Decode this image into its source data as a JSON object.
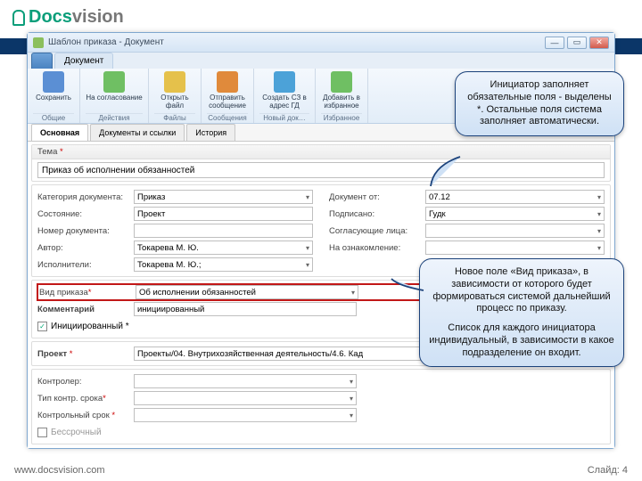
{
  "brand": {
    "name1": "Docs",
    "name2": "vision"
  },
  "window": {
    "title": "Шаблон приказа - Документ",
    "min": "—",
    "max": "▭",
    "close": "✕"
  },
  "ribbon": {
    "file_tab": "",
    "doc_tab": "Документ",
    "groups": [
      {
        "label": "Общие",
        "items": [
          {
            "label": "Сохранить",
            "color": "#5b8fd4"
          }
        ]
      },
      {
        "label": "Действия",
        "items": [
          {
            "label": "На согласование",
            "color": "#6fbf63"
          }
        ]
      },
      {
        "label": "Файлы",
        "items": [
          {
            "label": "Открыть файл",
            "color": "#e5c14b"
          }
        ]
      },
      {
        "label": "Сообщения",
        "items": [
          {
            "label": "Отправить сообщение",
            "color": "#e08a3b"
          }
        ]
      },
      {
        "label": "Новый док…",
        "items": [
          {
            "label": "Создать СЗ в адрес ГД",
            "color": "#4ca2d8"
          }
        ]
      },
      {
        "label": "Избранное",
        "items": [
          {
            "label": "Добавить в избранное",
            "color": "#6fbf63"
          }
        ]
      }
    ]
  },
  "doctabs": {
    "t1": "Основная",
    "t2": "Документы и ссылки",
    "t3": "История"
  },
  "form": {
    "theme_label": "Тема",
    "theme_value": "Приказ об исполнении обязанностей",
    "left": {
      "category_l": "Категория документа:",
      "category_v": "Приказ",
      "state_l": "Состояние:",
      "state_v": "Проект",
      "number_l": "Номер документа:",
      "number_v": "",
      "author_l": "Автор:",
      "author_v": "Токарева М. Ю.",
      "executors_l": "Исполнители:",
      "executors_v": "Токарева М. Ю.;"
    },
    "right": {
      "docdate_l": "Документ от:",
      "docdate_v": "07.12",
      "signed_l": "Подписано:",
      "signed_v": "Гудк",
      "agree_l": "Согласующие лица:",
      "agree_v": "",
      "review_l": "На ознакомление:",
      "review_v": ""
    },
    "kind_l": "Вид приказа",
    "kind_v": "Об исполнении обязанностей",
    "comment_l": "Комментарий",
    "comment_v": "инициированный",
    "initiated_l": "Инициированный",
    "project_l": "Проект",
    "project_v": "Проекты/04. Внутрихозяйственная  деятельность/4.6. Кад",
    "controller_l": "Контролер:",
    "controller_v": "",
    "termtype_l": "Тип контр. срока",
    "termtype_v": "",
    "term_l": "Контрольный срок",
    "term_v": "",
    "perm_l": "Бессрочный"
  },
  "callouts": {
    "c1": "Инициатор заполняет обязательные поля - выделены *. Остальные поля система заполняет автоматически.",
    "c2a": "Новое поле «Вид приказа», в зависимости от которого будет формироваться системой дальнейший процесс по приказу.",
    "c2b": "Список для каждого инициатора индивидуальный, в зависимости в какое подразделение он входит."
  },
  "footer": {
    "url": "www.docsvision.com",
    "slide": "Слайд: 4"
  }
}
